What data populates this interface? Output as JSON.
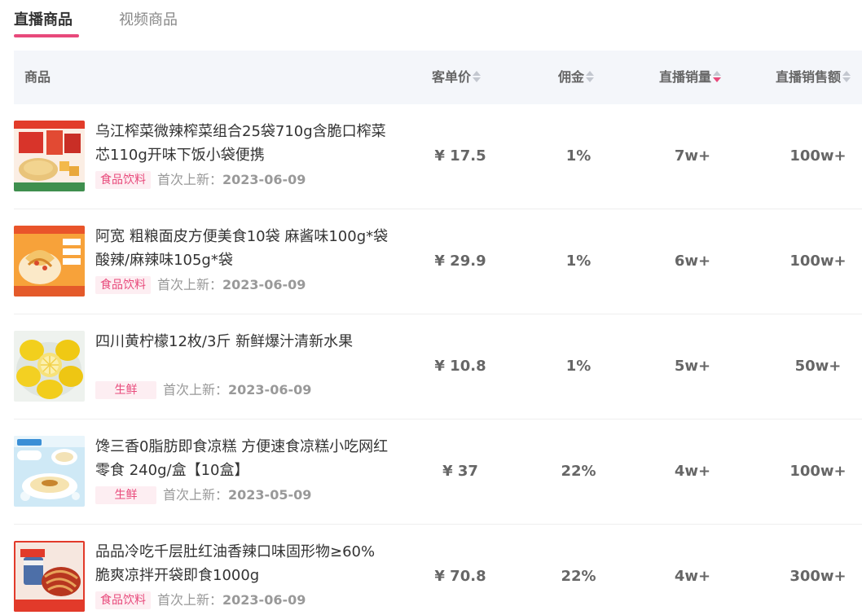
{
  "tabs": [
    {
      "label": "直播商品",
      "active": true
    },
    {
      "label": "视频商品",
      "active": false
    }
  ],
  "accent_color": "#e8497b",
  "table": {
    "headers": {
      "product": "商品",
      "price": "客单价",
      "commission": "佣金",
      "live_volume": "直播销量",
      "live_sales": "直播销售额"
    },
    "sort": {
      "column": "live_volume",
      "order": "desc"
    },
    "first_listed_label": "首次上新：",
    "rows": [
      {
        "title": "乌江榨菜微辣榨菜组合25袋710g含脆口榨菜芯110g开味下饭小袋便携",
        "category": "食品饮料",
        "first_listed": "2023-06-09",
        "price": "¥ 17.5",
        "commission": "1%",
        "live_volume": "7w+",
        "live_sales": "100w+",
        "thumb_icon": "pickled-vegetable-product-image"
      },
      {
        "title": "阿宽 粗粮面皮方便美食10袋 麻酱味100g*袋 酸辣/麻辣味105g*袋",
        "category": "食品饮料",
        "first_listed": "2023-06-09",
        "price": "¥ 29.9",
        "commission": "1%",
        "live_volume": "6w+",
        "live_sales": "100w+",
        "thumb_icon": "noodle-product-image"
      },
      {
        "title": "四川黄柠檬12枚/3斤 新鲜爆汁清新水果",
        "category": "生鲜",
        "first_listed": "2023-06-09",
        "price": "¥ 10.8",
        "commission": "1%",
        "live_volume": "5w+",
        "live_sales": "50w+",
        "thumb_icon": "lemon-product-image"
      },
      {
        "title": "馋三香0脂肪即食凉糕 方便速食凉糕小吃网红零食 240g/盒【10盒】",
        "category": "生鲜",
        "first_listed": "2023-05-09",
        "price": "¥ 37",
        "commission": "22%",
        "live_volume": "4w+",
        "live_sales": "100w+",
        "thumb_icon": "jelly-cake-product-image"
      },
      {
        "title": "品品冷吃千层肚红油香辣口味固形物≥60%脆爽凉拌开袋即食1000g",
        "category": "食品饮料",
        "first_listed": "2023-06-09",
        "price": "¥ 70.8",
        "commission": "22%",
        "live_volume": "4w+",
        "live_sales": "300w+",
        "thumb_icon": "spicy-tripe-product-image"
      }
    ]
  }
}
